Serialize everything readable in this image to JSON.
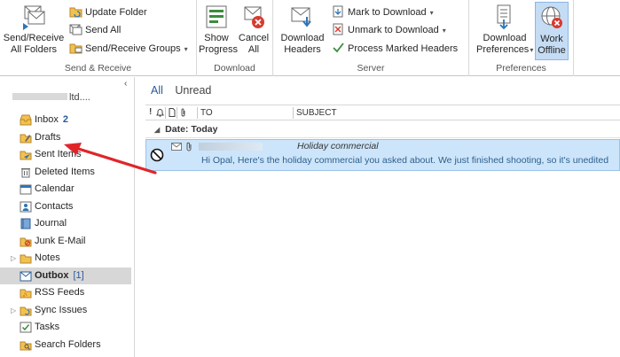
{
  "ribbon": {
    "send_receive": {
      "label": "Send & Receive",
      "send_receive_all_line1": "Send/Receive",
      "send_receive_all_line2": "All Folders",
      "update_folder": "Update Folder",
      "send_all": "Send All",
      "send_receive_groups": "Send/Receive Groups"
    },
    "download": {
      "label": "Download",
      "show_progress_line1": "Show",
      "show_progress_line2": "Progress",
      "cancel_all_line1": "Cancel",
      "cancel_all_line2": "All"
    },
    "server": {
      "label": "Server",
      "download_headers_line1": "Download",
      "download_headers_line2": "Headers",
      "mark_to_download": "Mark to Download",
      "unmark_to_download": "Unmark to Download",
      "process_marked_headers": "Process Marked Headers"
    },
    "preferences": {
      "label": "Preferences",
      "download_preferences_line1": "Download",
      "download_preferences_line2": "Preferences",
      "work_offline_line1": "Work",
      "work_offline_line2": "Offline"
    }
  },
  "nav": {
    "collapse_glyph": "‹",
    "account_suffix": "ltd....",
    "items": [
      {
        "label": "Inbox",
        "count": "2",
        "icon": "inbox-icon"
      },
      {
        "label": "Drafts",
        "count": "",
        "icon": "drafts-icon"
      },
      {
        "label": "Sent Items",
        "count": "",
        "icon": "sent-items-icon"
      },
      {
        "label": "Deleted Items",
        "count": "",
        "icon": "deleted-items-icon"
      },
      {
        "label": "Calendar",
        "count": "",
        "icon": "calendar-icon"
      },
      {
        "label": "Contacts",
        "count": "",
        "icon": "contacts-icon"
      },
      {
        "label": "Journal",
        "count": "",
        "icon": "journal-icon"
      },
      {
        "label": "Junk E-Mail",
        "count": "",
        "icon": "junk-email-icon"
      },
      {
        "label": "Notes",
        "count": "",
        "icon": "notes-icon"
      },
      {
        "label": "Outbox",
        "count": "[1]",
        "icon": "outbox-icon"
      },
      {
        "label": "RSS Feeds",
        "count": "",
        "icon": "rss-feeds-icon"
      },
      {
        "label": "Sync Issues",
        "count": "",
        "icon": "sync-issues-icon"
      },
      {
        "label": "Tasks",
        "count": "",
        "icon": "tasks-icon"
      },
      {
        "label": "Search Folders",
        "count": "",
        "icon": "search-folders-icon"
      }
    ]
  },
  "list": {
    "filters": {
      "all": "All",
      "unread": "Unread"
    },
    "columns": {
      "importance": "!",
      "to": "TO",
      "subject": "SUBJECT"
    },
    "group_label": "Date: Today",
    "message": {
      "subject": "Holiday commercial",
      "preview": "Hi Opal,  Here's the holiday commercial you asked about. We just finished shooting, so it's unedited"
    }
  },
  "colors": {
    "accent": "#2b579a",
    "selected_row": "#cde5fa",
    "arrow": "#e0252a",
    "work_offline_active": "#c5dcf5"
  }
}
